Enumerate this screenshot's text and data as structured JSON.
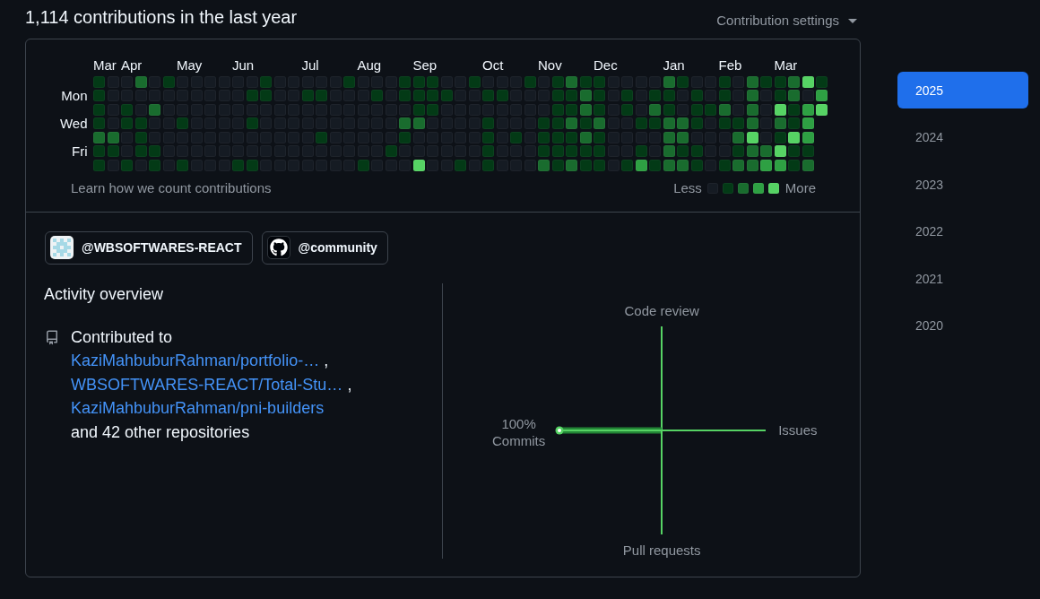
{
  "header": {
    "title": "1,114 contributions in the last year",
    "settings_button": "Contribution settings"
  },
  "calendar": {
    "day_labels": [
      "Mon",
      "Wed",
      "Fri"
    ],
    "weeks": [
      {
        "month": "Mar",
        "days": [
          {
            "color": "#033a16"
          },
          {
            "color": "#033a16"
          },
          {
            "color": "#033a16"
          },
          {
            "color": "#033a16"
          },
          {
            "color": "#196c2e"
          },
          {
            "color": "#033a16"
          },
          {
            "color": "#033a16"
          }
        ]
      },
      {
        "days": [
          {
            "color": "#151b23"
          },
          {
            "color": "#151b23"
          },
          {
            "color": "#151b23"
          },
          {
            "color": "#151b23"
          },
          {
            "color": "#196c2e"
          },
          {
            "color": "#033a16"
          },
          {
            "color": "#151b23"
          }
        ]
      },
      {
        "month": "Apr",
        "days": [
          {
            "color": "#151b23"
          },
          {
            "color": "#151b23"
          },
          {
            "color": "#033a16"
          },
          {
            "color": "#033a16"
          },
          {
            "color": "#151b23"
          },
          {
            "color": "#151b23"
          },
          {
            "color": "#033a16"
          }
        ]
      },
      {
        "days": [
          {
            "color": "#196c2e"
          },
          {
            "color": "#151b23"
          },
          {
            "color": "#151b23"
          },
          {
            "color": "#033a16"
          },
          {
            "color": "#033a16"
          },
          {
            "color": "#033a16"
          },
          {
            "color": "#151b23"
          }
        ]
      },
      {
        "days": [
          {
            "color": "#151b23"
          },
          {
            "color": "#151b23"
          },
          {
            "color": "#196c2e"
          },
          {
            "color": "#151b23"
          },
          {
            "color": "#151b23"
          },
          {
            "color": "#033a16"
          },
          {
            "color": "#033a16"
          }
        ]
      },
      {
        "days": [
          {
            "color": "#033a16"
          },
          {
            "color": "#151b23"
          },
          {
            "color": "#151b23"
          },
          {
            "color": "#151b23"
          },
          {
            "color": "#151b23"
          },
          {
            "color": "#151b23"
          },
          {
            "color": "#151b23"
          }
        ]
      },
      {
        "month": "May",
        "days": [
          {
            "color": "#151b23"
          },
          {
            "color": "#151b23"
          },
          {
            "color": "#151b23"
          },
          {
            "color": "#033a16"
          },
          {
            "color": "#151b23"
          },
          {
            "color": "#151b23"
          },
          {
            "color": "#033a16"
          }
        ]
      },
      {
        "days": [
          {
            "color": "#151b23"
          },
          {
            "color": "#151b23"
          },
          {
            "color": "#151b23"
          },
          {
            "color": "#151b23"
          },
          {
            "color": "#151b23"
          },
          {
            "color": "#151b23"
          },
          {
            "color": "#151b23"
          }
        ]
      },
      {
        "days": [
          {
            "color": "#151b23"
          },
          {
            "color": "#151b23"
          },
          {
            "color": "#151b23"
          },
          {
            "color": "#151b23"
          },
          {
            "color": "#151b23"
          },
          {
            "color": "#151b23"
          },
          {
            "color": "#151b23"
          }
        ]
      },
      {
        "days": [
          {
            "color": "#151b23"
          },
          {
            "color": "#151b23"
          },
          {
            "color": "#151b23"
          },
          {
            "color": "#151b23"
          },
          {
            "color": "#151b23"
          },
          {
            "color": "#151b23"
          },
          {
            "color": "#151b23"
          }
        ]
      },
      {
        "month": "Jun",
        "days": [
          {
            "color": "#151b23"
          },
          {
            "color": "#151b23"
          },
          {
            "color": "#151b23"
          },
          {
            "color": "#151b23"
          },
          {
            "color": "#151b23"
          },
          {
            "color": "#151b23"
          },
          {
            "color": "#033a16"
          }
        ]
      },
      {
        "days": [
          {
            "color": "#151b23"
          },
          {
            "color": "#033a16"
          },
          {
            "color": "#151b23"
          },
          {
            "color": "#033a16"
          },
          {
            "color": "#151b23"
          },
          {
            "color": "#151b23"
          },
          {
            "color": "#033a16"
          }
        ]
      },
      {
        "days": [
          {
            "color": "#033a16"
          },
          {
            "color": "#033a16"
          },
          {
            "color": "#151b23"
          },
          {
            "color": "#151b23"
          },
          {
            "color": "#151b23"
          },
          {
            "color": "#151b23"
          },
          {
            "color": "#151b23"
          }
        ]
      },
      {
        "days": [
          {
            "color": "#151b23"
          },
          {
            "color": "#151b23"
          },
          {
            "color": "#151b23"
          },
          {
            "color": "#151b23"
          },
          {
            "color": "#151b23"
          },
          {
            "color": "#151b23"
          },
          {
            "color": "#151b23"
          }
        ]
      },
      {
        "days": [
          {
            "color": "#151b23"
          },
          {
            "color": "#151b23"
          },
          {
            "color": "#151b23"
          },
          {
            "color": "#151b23"
          },
          {
            "color": "#151b23"
          },
          {
            "color": "#151b23"
          },
          {
            "color": "#151b23"
          }
        ]
      },
      {
        "month": "Jul",
        "days": [
          {
            "color": "#151b23"
          },
          {
            "color": "#033a16"
          },
          {
            "color": "#151b23"
          },
          {
            "color": "#151b23"
          },
          {
            "color": "#151b23"
          },
          {
            "color": "#151b23"
          },
          {
            "color": "#151b23"
          }
        ]
      },
      {
        "days": [
          {
            "color": "#151b23"
          },
          {
            "color": "#033a16"
          },
          {
            "color": "#151b23"
          },
          {
            "color": "#151b23"
          },
          {
            "color": "#033a16"
          },
          {
            "color": "#151b23"
          },
          {
            "color": "#151b23"
          }
        ]
      },
      {
        "days": [
          {
            "color": "#151b23"
          },
          {
            "color": "#151b23"
          },
          {
            "color": "#151b23"
          },
          {
            "color": "#151b23"
          },
          {
            "color": "#151b23"
          },
          {
            "color": "#151b23"
          },
          {
            "color": "#151b23"
          }
        ]
      },
      {
        "days": [
          {
            "color": "#033a16"
          },
          {
            "color": "#151b23"
          },
          {
            "color": "#151b23"
          },
          {
            "color": "#151b23"
          },
          {
            "color": "#151b23"
          },
          {
            "color": "#151b23"
          },
          {
            "color": "#151b23"
          }
        ]
      },
      {
        "month": "Aug",
        "days": [
          {
            "color": "#151b23"
          },
          {
            "color": "#151b23"
          },
          {
            "color": "#151b23"
          },
          {
            "color": "#151b23"
          },
          {
            "color": "#151b23"
          },
          {
            "color": "#151b23"
          },
          {
            "color": "#033a16"
          }
        ]
      },
      {
        "days": [
          {
            "color": "#151b23"
          },
          {
            "color": "#033a16"
          },
          {
            "color": "#151b23"
          },
          {
            "color": "#151b23"
          },
          {
            "color": "#151b23"
          },
          {
            "color": "#151b23"
          },
          {
            "color": "#151b23"
          }
        ]
      },
      {
        "days": [
          {
            "color": "#151b23"
          },
          {
            "color": "#151b23"
          },
          {
            "color": "#151b23"
          },
          {
            "color": "#151b23"
          },
          {
            "color": "#151b23"
          },
          {
            "color": "#033a16"
          },
          {
            "color": "#151b23"
          }
        ]
      },
      {
        "days": [
          {
            "color": "#033a16"
          },
          {
            "color": "#033a16"
          },
          {
            "color": "#151b23"
          },
          {
            "color": "#196c2e"
          },
          {
            "color": "#033a16"
          },
          {
            "color": "#151b23"
          },
          {
            "color": "#151b23"
          }
        ]
      },
      {
        "month": "Sep",
        "days": [
          {
            "color": "#033a16"
          },
          {
            "color": "#033a16"
          },
          {
            "color": "#033a16"
          },
          {
            "color": "#196c2e"
          },
          {
            "color": "#151b23"
          },
          {
            "color": "#151b23"
          },
          {
            "color": "#56d364"
          }
        ]
      },
      {
        "days": [
          {
            "color": "#033a16"
          },
          {
            "color": "#033a16"
          },
          {
            "color": "#033a16"
          },
          {
            "color": "#151b23"
          },
          {
            "color": "#151b23"
          },
          {
            "color": "#151b23"
          },
          {
            "color": "#151b23"
          }
        ]
      },
      {
        "days": [
          {
            "color": "#151b23"
          },
          {
            "color": "#033a16"
          },
          {
            "color": "#151b23"
          },
          {
            "color": "#151b23"
          },
          {
            "color": "#151b23"
          },
          {
            "color": "#151b23"
          },
          {
            "color": "#151b23"
          }
        ]
      },
      {
        "days": [
          {
            "color": "#151b23"
          },
          {
            "color": "#151b23"
          },
          {
            "color": "#151b23"
          },
          {
            "color": "#151b23"
          },
          {
            "color": "#151b23"
          },
          {
            "color": "#151b23"
          },
          {
            "color": "#033a16"
          }
        ]
      },
      {
        "days": [
          {
            "color": "#033a16"
          },
          {
            "color": "#151b23"
          },
          {
            "color": "#151b23"
          },
          {
            "color": "#151b23"
          },
          {
            "color": "#151b23"
          },
          {
            "color": "#151b23"
          },
          {
            "color": "#151b23"
          }
        ]
      },
      {
        "month": "Oct",
        "days": [
          {
            "color": "#151b23"
          },
          {
            "color": "#033a16"
          },
          {
            "color": "#151b23"
          },
          {
            "color": "#033a16"
          },
          {
            "color": "#033a16"
          },
          {
            "color": "#033a16"
          },
          {
            "color": "#033a16"
          }
        ]
      },
      {
        "days": [
          {
            "color": "#151b23"
          },
          {
            "color": "#033a16"
          },
          {
            "color": "#151b23"
          },
          {
            "color": "#151b23"
          },
          {
            "color": "#151b23"
          },
          {
            "color": "#151b23"
          },
          {
            "color": "#151b23"
          }
        ]
      },
      {
        "days": [
          {
            "color": "#151b23"
          },
          {
            "color": "#151b23"
          },
          {
            "color": "#151b23"
          },
          {
            "color": "#151b23"
          },
          {
            "color": "#033a16"
          },
          {
            "color": "#151b23"
          },
          {
            "color": "#151b23"
          }
        ]
      },
      {
        "days": [
          {
            "color": "#033a16"
          },
          {
            "color": "#151b23"
          },
          {
            "color": "#151b23"
          },
          {
            "color": "#151b23"
          },
          {
            "color": "#151b23"
          },
          {
            "color": "#151b23"
          },
          {
            "color": "#151b23"
          }
        ]
      },
      {
        "month": "Nov",
        "days": [
          {
            "color": "#151b23"
          },
          {
            "color": "#151b23"
          },
          {
            "color": "#151b23"
          },
          {
            "color": "#033a16"
          },
          {
            "color": "#033a16"
          },
          {
            "color": "#033a16"
          },
          {
            "color": "#196c2e"
          }
        ]
      },
      {
        "days": [
          {
            "color": "#033a16"
          },
          {
            "color": "#033a16"
          },
          {
            "color": "#033a16"
          },
          {
            "color": "#033a16"
          },
          {
            "color": "#033a16"
          },
          {
            "color": "#033a16"
          },
          {
            "color": "#033a16"
          }
        ]
      },
      {
        "days": [
          {
            "color": "#196c2e"
          },
          {
            "color": "#033a16"
          },
          {
            "color": "#033a16"
          },
          {
            "color": "#196c2e"
          },
          {
            "color": "#033a16"
          },
          {
            "color": "#033a16"
          },
          {
            "color": "#196c2e"
          }
        ]
      },
      {
        "days": [
          {
            "color": "#033a16"
          },
          {
            "color": "#196c2e"
          },
          {
            "color": "#196c2e"
          },
          {
            "color": "#033a16"
          },
          {
            "color": "#196c2e"
          },
          {
            "color": "#033a16"
          },
          {
            "color": "#033a16"
          }
        ]
      },
      {
        "month": "Dec",
        "days": [
          {
            "color": "#033a16"
          },
          {
            "color": "#033a16"
          },
          {
            "color": "#033a16"
          },
          {
            "color": "#196c2e"
          },
          {
            "color": "#033a16"
          },
          {
            "color": "#033a16"
          },
          {
            "color": "#033a16"
          }
        ]
      },
      {
        "days": [
          {
            "color": "#151b23"
          },
          {
            "color": "#151b23"
          },
          {
            "color": "#151b23"
          },
          {
            "color": "#151b23"
          },
          {
            "color": "#151b23"
          },
          {
            "color": "#151b23"
          },
          {
            "color": "#151b23"
          }
        ]
      },
      {
        "days": [
          {
            "color": "#151b23"
          },
          {
            "color": "#033a16"
          },
          {
            "color": "#033a16"
          },
          {
            "color": "#151b23"
          },
          {
            "color": "#151b23"
          },
          {
            "color": "#151b23"
          },
          {
            "color": "#033a16"
          }
        ]
      },
      {
        "days": [
          {
            "color": "#151b23"
          },
          {
            "color": "#151b23"
          },
          {
            "color": "#151b23"
          },
          {
            "color": "#033a16"
          },
          {
            "color": "#151b23"
          },
          {
            "color": "#033a16"
          },
          {
            "color": "#2ea043"
          }
        ]
      },
      {
        "days": [
          {
            "color": "#151b23"
          },
          {
            "color": "#033a16"
          },
          {
            "color": "#196c2e"
          },
          {
            "color": "#033a16"
          },
          {
            "color": "#151b23"
          },
          {
            "color": "#151b23"
          },
          {
            "color": "#033a16"
          }
        ]
      },
      {
        "month": "Jan",
        "days": [
          {
            "color": "#196c2e"
          },
          {
            "color": "#033a16"
          },
          {
            "color": "#033a16"
          },
          {
            "color": "#196c2e"
          },
          {
            "color": "#196c2e"
          },
          {
            "color": "#196c2e"
          },
          {
            "color": "#196c2e"
          }
        ]
      },
      {
        "days": [
          {
            "color": "#033a16"
          },
          {
            "color": "#151b23"
          },
          {
            "color": "#151b23"
          },
          {
            "color": "#196c2e"
          },
          {
            "color": "#196c2e"
          },
          {
            "color": "#033a16"
          },
          {
            "color": "#196c2e"
          }
        ]
      },
      {
        "days": [
          {
            "color": "#151b23"
          },
          {
            "color": "#033a16"
          },
          {
            "color": "#033a16"
          },
          {
            "color": "#033a16"
          },
          {
            "color": "#151b23"
          },
          {
            "color": "#033a16"
          },
          {
            "color": "#033a16"
          }
        ]
      },
      {
        "days": [
          {
            "color": "#151b23"
          },
          {
            "color": "#151b23"
          },
          {
            "color": "#033a16"
          },
          {
            "color": "#151b23"
          },
          {
            "color": "#151b23"
          },
          {
            "color": "#151b23"
          },
          {
            "color": "#151b23"
          }
        ]
      },
      {
        "month": "Feb",
        "days": [
          {
            "color": "#033a16"
          },
          {
            "color": "#033a16"
          },
          {
            "color": "#196c2e"
          },
          {
            "color": "#033a16"
          },
          {
            "color": "#151b23"
          },
          {
            "color": "#151b23"
          },
          {
            "color": "#033a16"
          }
        ]
      },
      {
        "days": [
          {
            "color": "#151b23"
          },
          {
            "color": "#151b23"
          },
          {
            "color": "#151b23"
          },
          {
            "color": "#033a16"
          },
          {
            "color": "#196c2e"
          },
          {
            "color": "#033a16"
          },
          {
            "color": "#196c2e"
          }
        ]
      },
      {
        "days": [
          {
            "color": "#196c2e"
          },
          {
            "color": "#196c2e"
          },
          {
            "color": "#196c2e"
          },
          {
            "color": "#196c2e"
          },
          {
            "color": "#56d364"
          },
          {
            "color": "#196c2e"
          },
          {
            "color": "#196c2e"
          }
        ]
      },
      {
        "days": [
          {
            "color": "#033a16"
          },
          {
            "color": "#151b23"
          },
          {
            "color": "#151b23"
          },
          {
            "color": "#151b23"
          },
          {
            "color": "#151b23"
          },
          {
            "color": "#196c2e"
          },
          {
            "color": "#2ea043"
          }
        ]
      },
      {
        "month": "Mar",
        "days": [
          {
            "color": "#033a16"
          },
          {
            "color": "#033a16"
          },
          {
            "color": "#56d364"
          },
          {
            "color": "#196c2e"
          },
          {
            "color": "#033a16"
          },
          {
            "color": "#56d364"
          },
          {
            "color": "#2ea043"
          }
        ]
      },
      {
        "days": [
          {
            "color": "#196c2e"
          },
          {
            "color": "#196c2e"
          },
          {
            "color": "#033a16"
          },
          {
            "color": "#033a16"
          },
          {
            "color": "#56d364"
          },
          {
            "color": "#033a16"
          },
          {
            "color": "#033a16"
          }
        ]
      },
      {
        "days": [
          {
            "color": "#56d364"
          },
          {
            "color": "#151b23"
          },
          {
            "color": "#2ea043"
          },
          {
            "color": "#2ea043"
          },
          {
            "color": "#2ea043"
          },
          {
            "color": "#033a16"
          },
          {
            "color": "#196c2e"
          }
        ]
      },
      {
        "days": [
          {
            "color": "#033a16"
          },
          {
            "color": "#2ea043"
          },
          {
            "color": "#56d364"
          }
        ]
      }
    ],
    "footer_link": "Learn how we count contributions",
    "legend": {
      "less": "Less",
      "more": "More",
      "swatches": [
        {
          "color": "#151b23"
        },
        {
          "color": "#033a16"
        },
        {
          "color": "#196c2e"
        },
        {
          "color": "#2ea043"
        },
        {
          "color": "#56d364"
        }
      ]
    }
  },
  "organizations": [
    {
      "kind": "pattern",
      "handle": "@WBSOFTWARES-REACT"
    },
    {
      "kind": "logo",
      "handle": "@community"
    }
  ],
  "activity_overview": {
    "title": "Activity overview",
    "intro": "Contributed to",
    "repositories": [
      {
        "name": "KaziMahbuburRahman/portfolio-…",
        "separator": ","
      },
      {
        "name": "WBSOFTWARES-REACT/Total-Stu…",
        "separator": ","
      },
      {
        "name": "KaziMahbuburRahman/pni-builders"
      }
    ],
    "more": "and 42 other repositories"
  },
  "activity_chart": {
    "axes": [
      {
        "label": "Code review"
      },
      {
        "label": "Commits",
        "percent": "100%",
        "level": 1
      },
      {
        "label": "Issues"
      },
      {
        "label": "Pull requests"
      }
    ]
  },
  "years": [
    {
      "label": "2025",
      "selected": true
    },
    {
      "label": "2024",
      "selected": false
    },
    {
      "label": "2023",
      "selected": false
    },
    {
      "label": "2022",
      "selected": false
    },
    {
      "label": "2021",
      "selected": false
    },
    {
      "label": "2020",
      "selected": false
    }
  ]
}
